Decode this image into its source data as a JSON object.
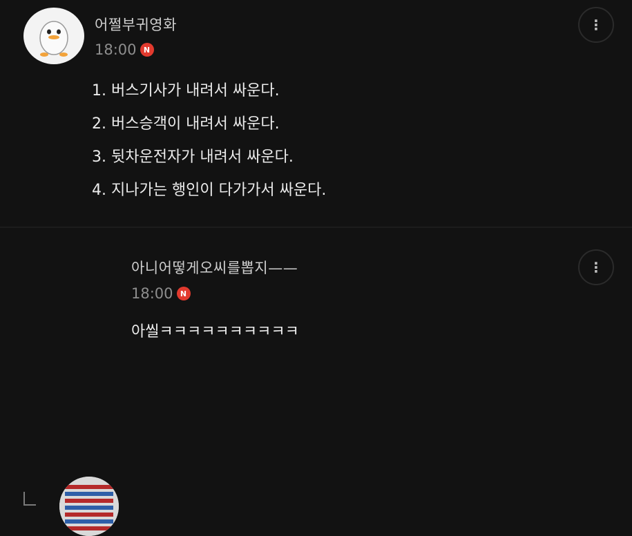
{
  "comment": {
    "nickname": "어쩔부귀영화",
    "time": "18:00",
    "badge": "N",
    "lines": [
      "1. 버스기사가 내려서 싸운다.",
      "2. 버스승객이 내려서 싸운다.",
      "3. 뒷차운전자가 내려서 싸운다.",
      "4. 지나가는 행인이 다가가서 싸운다."
    ],
    "more_icon": "more-vertical-icon"
  },
  "reply": {
    "nickname": "아니어떻게오씨를뽑지——",
    "time": "18:00",
    "badge": "N",
    "text": "아씰ㅋㅋㅋㅋㅋㅋㅋㅋㅋㅋ",
    "more_icon": "more-vertical-icon",
    "reply_icon": "reply-indent-icon"
  },
  "colors": {
    "background": "#121212",
    "badge": "#e23a2e",
    "text": "#ececec",
    "muted": "#8e8e8e"
  }
}
